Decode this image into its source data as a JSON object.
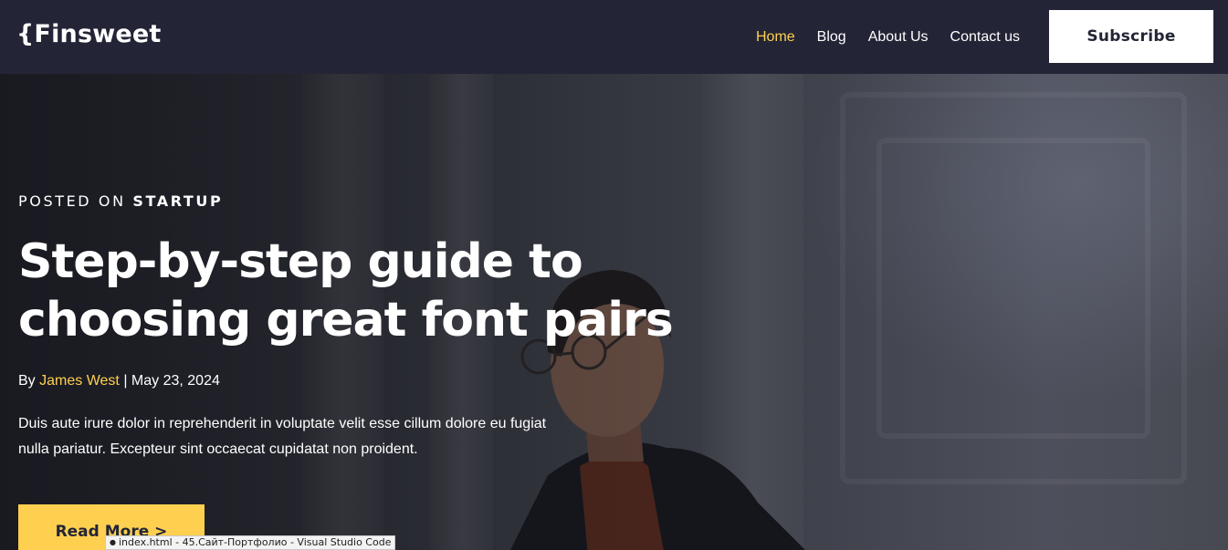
{
  "brand": {
    "logo_text": "{Finsweet"
  },
  "nav": {
    "items": [
      {
        "label": "Home",
        "active": true
      },
      {
        "label": "Blog",
        "active": false
      },
      {
        "label": "About Us",
        "active": false
      },
      {
        "label": "Contact us",
        "active": false
      }
    ],
    "subscribe_label": "Subscribe"
  },
  "hero": {
    "posted_prefix": "POSTED ON",
    "category": "STARTUP",
    "title": "Step-by-step guide to choosing great font pairs",
    "by_label": "By",
    "author": "James West",
    "separator": "|",
    "date": "May 23, 2024",
    "excerpt": "Duis aute irure dolor in reprehenderit in voluptate velit esse cillum dolore eu fugiat nulla pariatur. Excepteur sint occaecat cupidatat non proident.",
    "cta_label": "Read More >"
  },
  "tooltip": {
    "text": "index.html - 45.Сайт-Портфолио - Visual Studio Code"
  },
  "colors": {
    "navy": "#232536",
    "accent": "#FFD050",
    "white": "#FFFFFF"
  }
}
